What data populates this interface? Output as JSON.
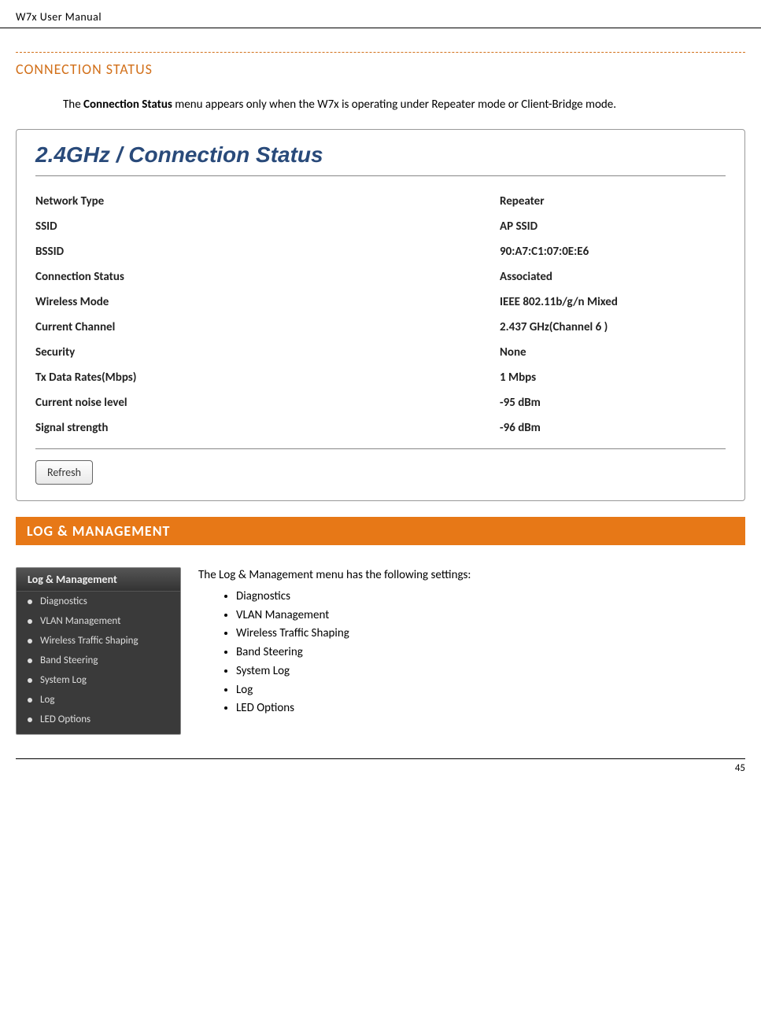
{
  "header": {
    "text": "W7x  User Manual"
  },
  "section1": {
    "title": "CONNECTION STATUS",
    "intro_pre": "The ",
    "intro_bold": "Connection Status",
    "intro_post": " menu appears only when the W7x is operating under Repeater mode or Client-Bridge mode."
  },
  "status_panel": {
    "title": "2.4GHz / Connection Status",
    "rows": [
      {
        "label": "Network Type",
        "value": "Repeater"
      },
      {
        "label": "SSID",
        "value": "AP SSID"
      },
      {
        "label": "BSSID",
        "value": "90:A7:C1:07:0E:E6"
      },
      {
        "label": "Connection Status",
        "value": "Associated"
      },
      {
        "label": "Wireless Mode",
        "value": "IEEE 802.11b/g/n Mixed"
      },
      {
        "label": "Current Channel",
        "value": "2.437 GHz(Channel 6 )"
      },
      {
        "label": "Security",
        "value": "None"
      },
      {
        "label": "Tx Data Rates(Mbps)",
        "value": "1 Mbps"
      },
      {
        "label": "Current noise level",
        "value": "-95 dBm"
      },
      {
        "label": "Signal strength",
        "value": "-96 dBm"
      }
    ],
    "refresh_label": "Refresh"
  },
  "section2": {
    "title": "LOG & MANAGEMENT",
    "menu_header": "Log & Management",
    "menu_items": [
      "Diagnostics",
      "VLAN Management",
      "Wireless Traffic Shaping",
      "Band Steering",
      "System Log",
      "Log",
      "LED Options"
    ],
    "intro": "The Log & Management menu has the following settings:",
    "bullets": [
      "Diagnostics",
      "VLAN Management",
      "Wireless Traffic Shaping",
      "Band Steering",
      "System Log",
      "Log",
      "LED Options"
    ]
  },
  "footer": {
    "page": "45"
  }
}
